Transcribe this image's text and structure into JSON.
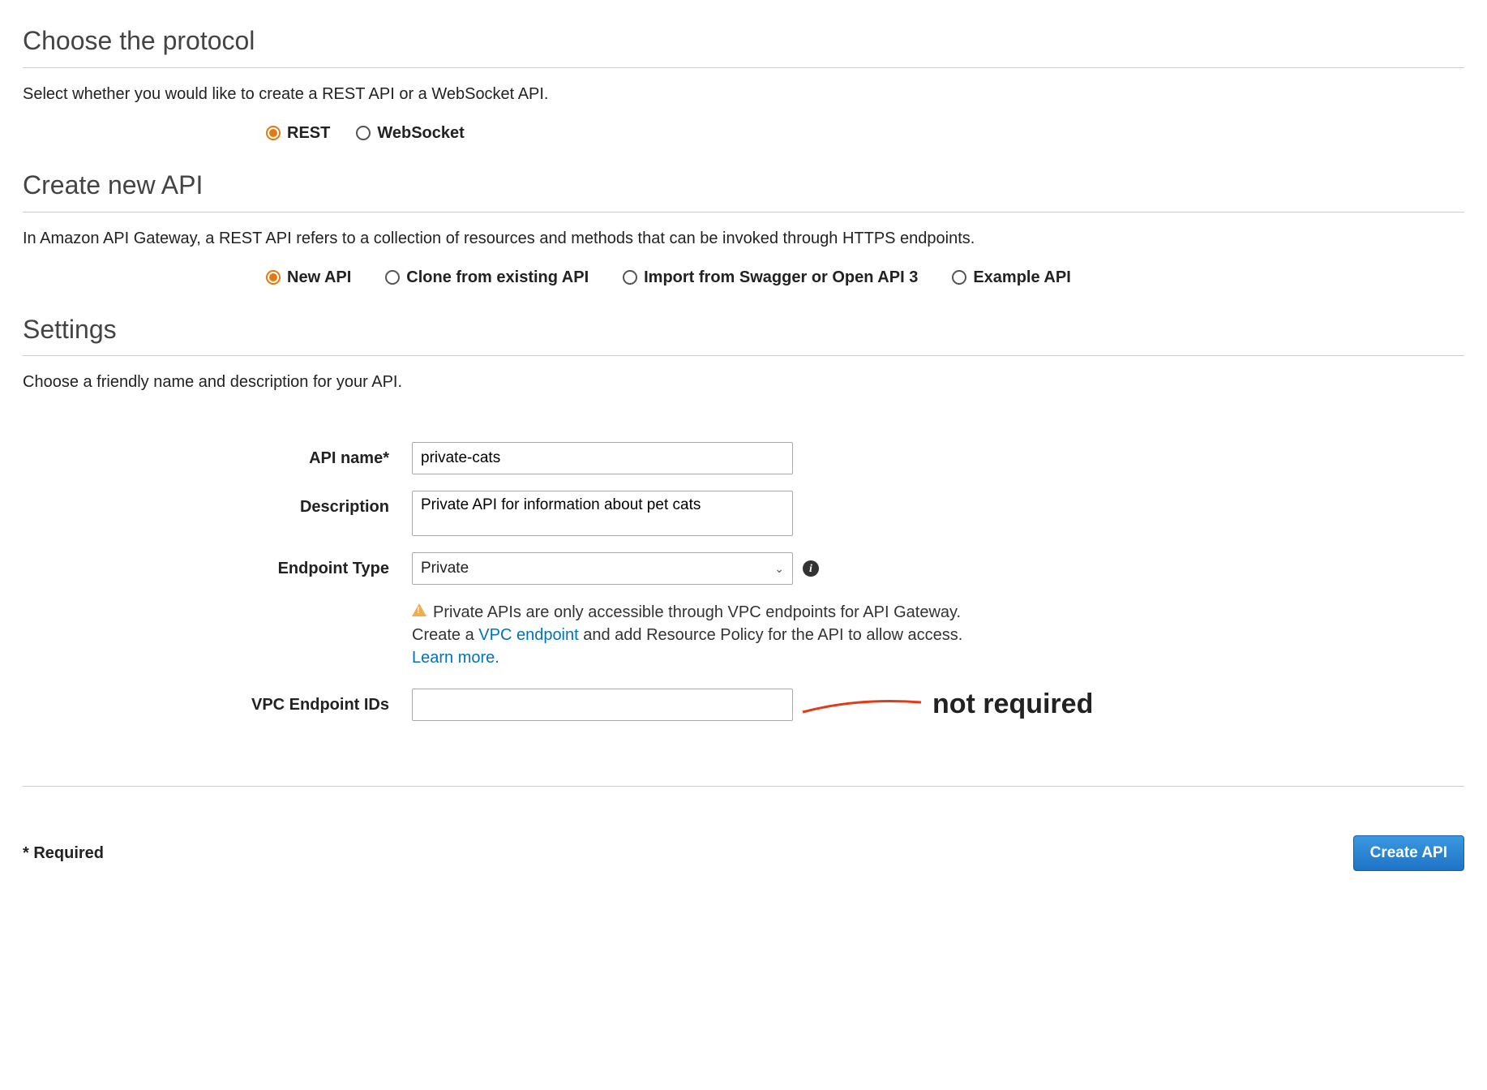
{
  "protocol": {
    "heading": "Choose the protocol",
    "desc": "Select whether you would like to create a REST API or a WebSocket API.",
    "options": {
      "rest": "REST",
      "websocket": "WebSocket"
    }
  },
  "create": {
    "heading": "Create new API",
    "desc": "In Amazon API Gateway, a REST API refers to a collection of resources and methods that can be invoked through HTTPS endpoints.",
    "options": {
      "new": "New API",
      "clone": "Clone from existing API",
      "import": "Import from Swagger or Open API 3",
      "example": "Example API"
    }
  },
  "settings": {
    "heading": "Settings",
    "desc": "Choose a friendly name and description for your API.",
    "labels": {
      "api_name": "API name*",
      "description": "Description",
      "endpoint_type": "Endpoint Type",
      "vpc_endpoint_ids": "VPC Endpoint IDs"
    },
    "values": {
      "api_name": "private-cats",
      "description": "Private API for information about pet cats",
      "endpoint_type": "Private",
      "vpc_endpoint_ids": ""
    },
    "warning": {
      "text1": "Private APIs are only accessible through VPC endpoints for API Gateway.",
      "text2a": "Create a ",
      "link1": "VPC endpoint",
      "text2b": " and add Resource Policy for the API to allow access.",
      "link2": "Learn more."
    }
  },
  "annotation": "not required",
  "footer": {
    "required": "* Required",
    "button": "Create API"
  }
}
